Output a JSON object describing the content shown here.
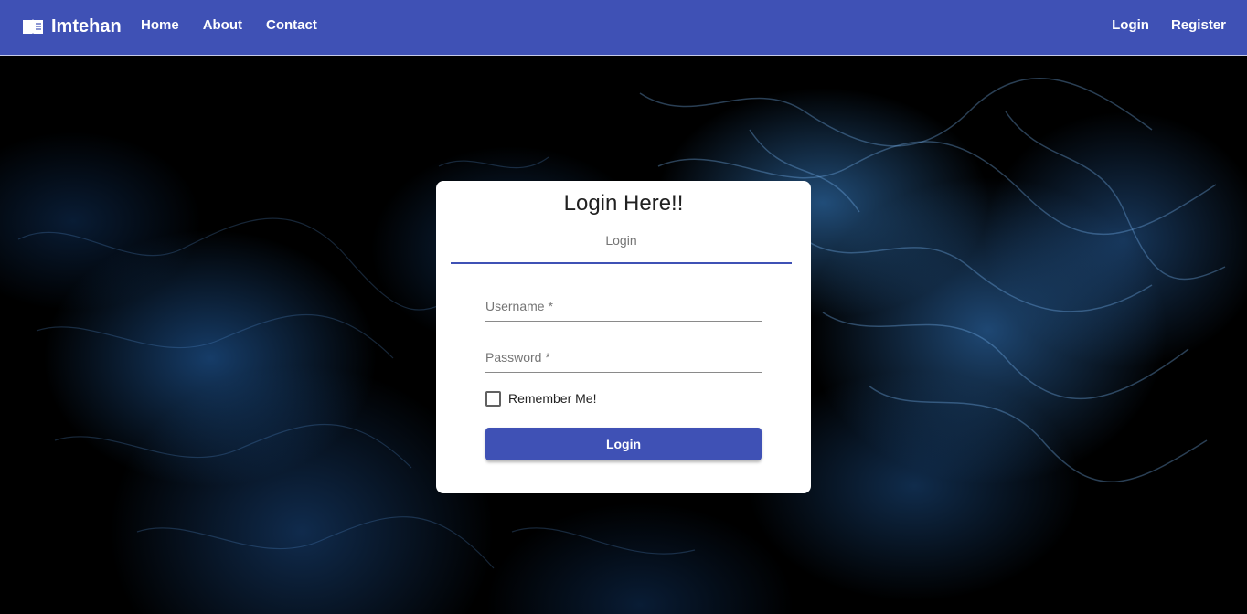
{
  "navbar": {
    "brand_icon": "open-book-icon",
    "brand_name": "Imtehan",
    "left_links": [
      "Home",
      "About",
      "Contact"
    ],
    "right_links": [
      "Login",
      "Register"
    ],
    "background_color": "#3f51b5"
  },
  "background": {
    "description_color": "#1e5aa0"
  },
  "login_card": {
    "title": "Login Here!!",
    "tab_label": "Login",
    "username_label": "Username *",
    "password_label": "Password *",
    "remember_label": "Remember Me!",
    "remember_checked": false,
    "submit_label": "Login",
    "accent_color": "#3f51b5"
  }
}
